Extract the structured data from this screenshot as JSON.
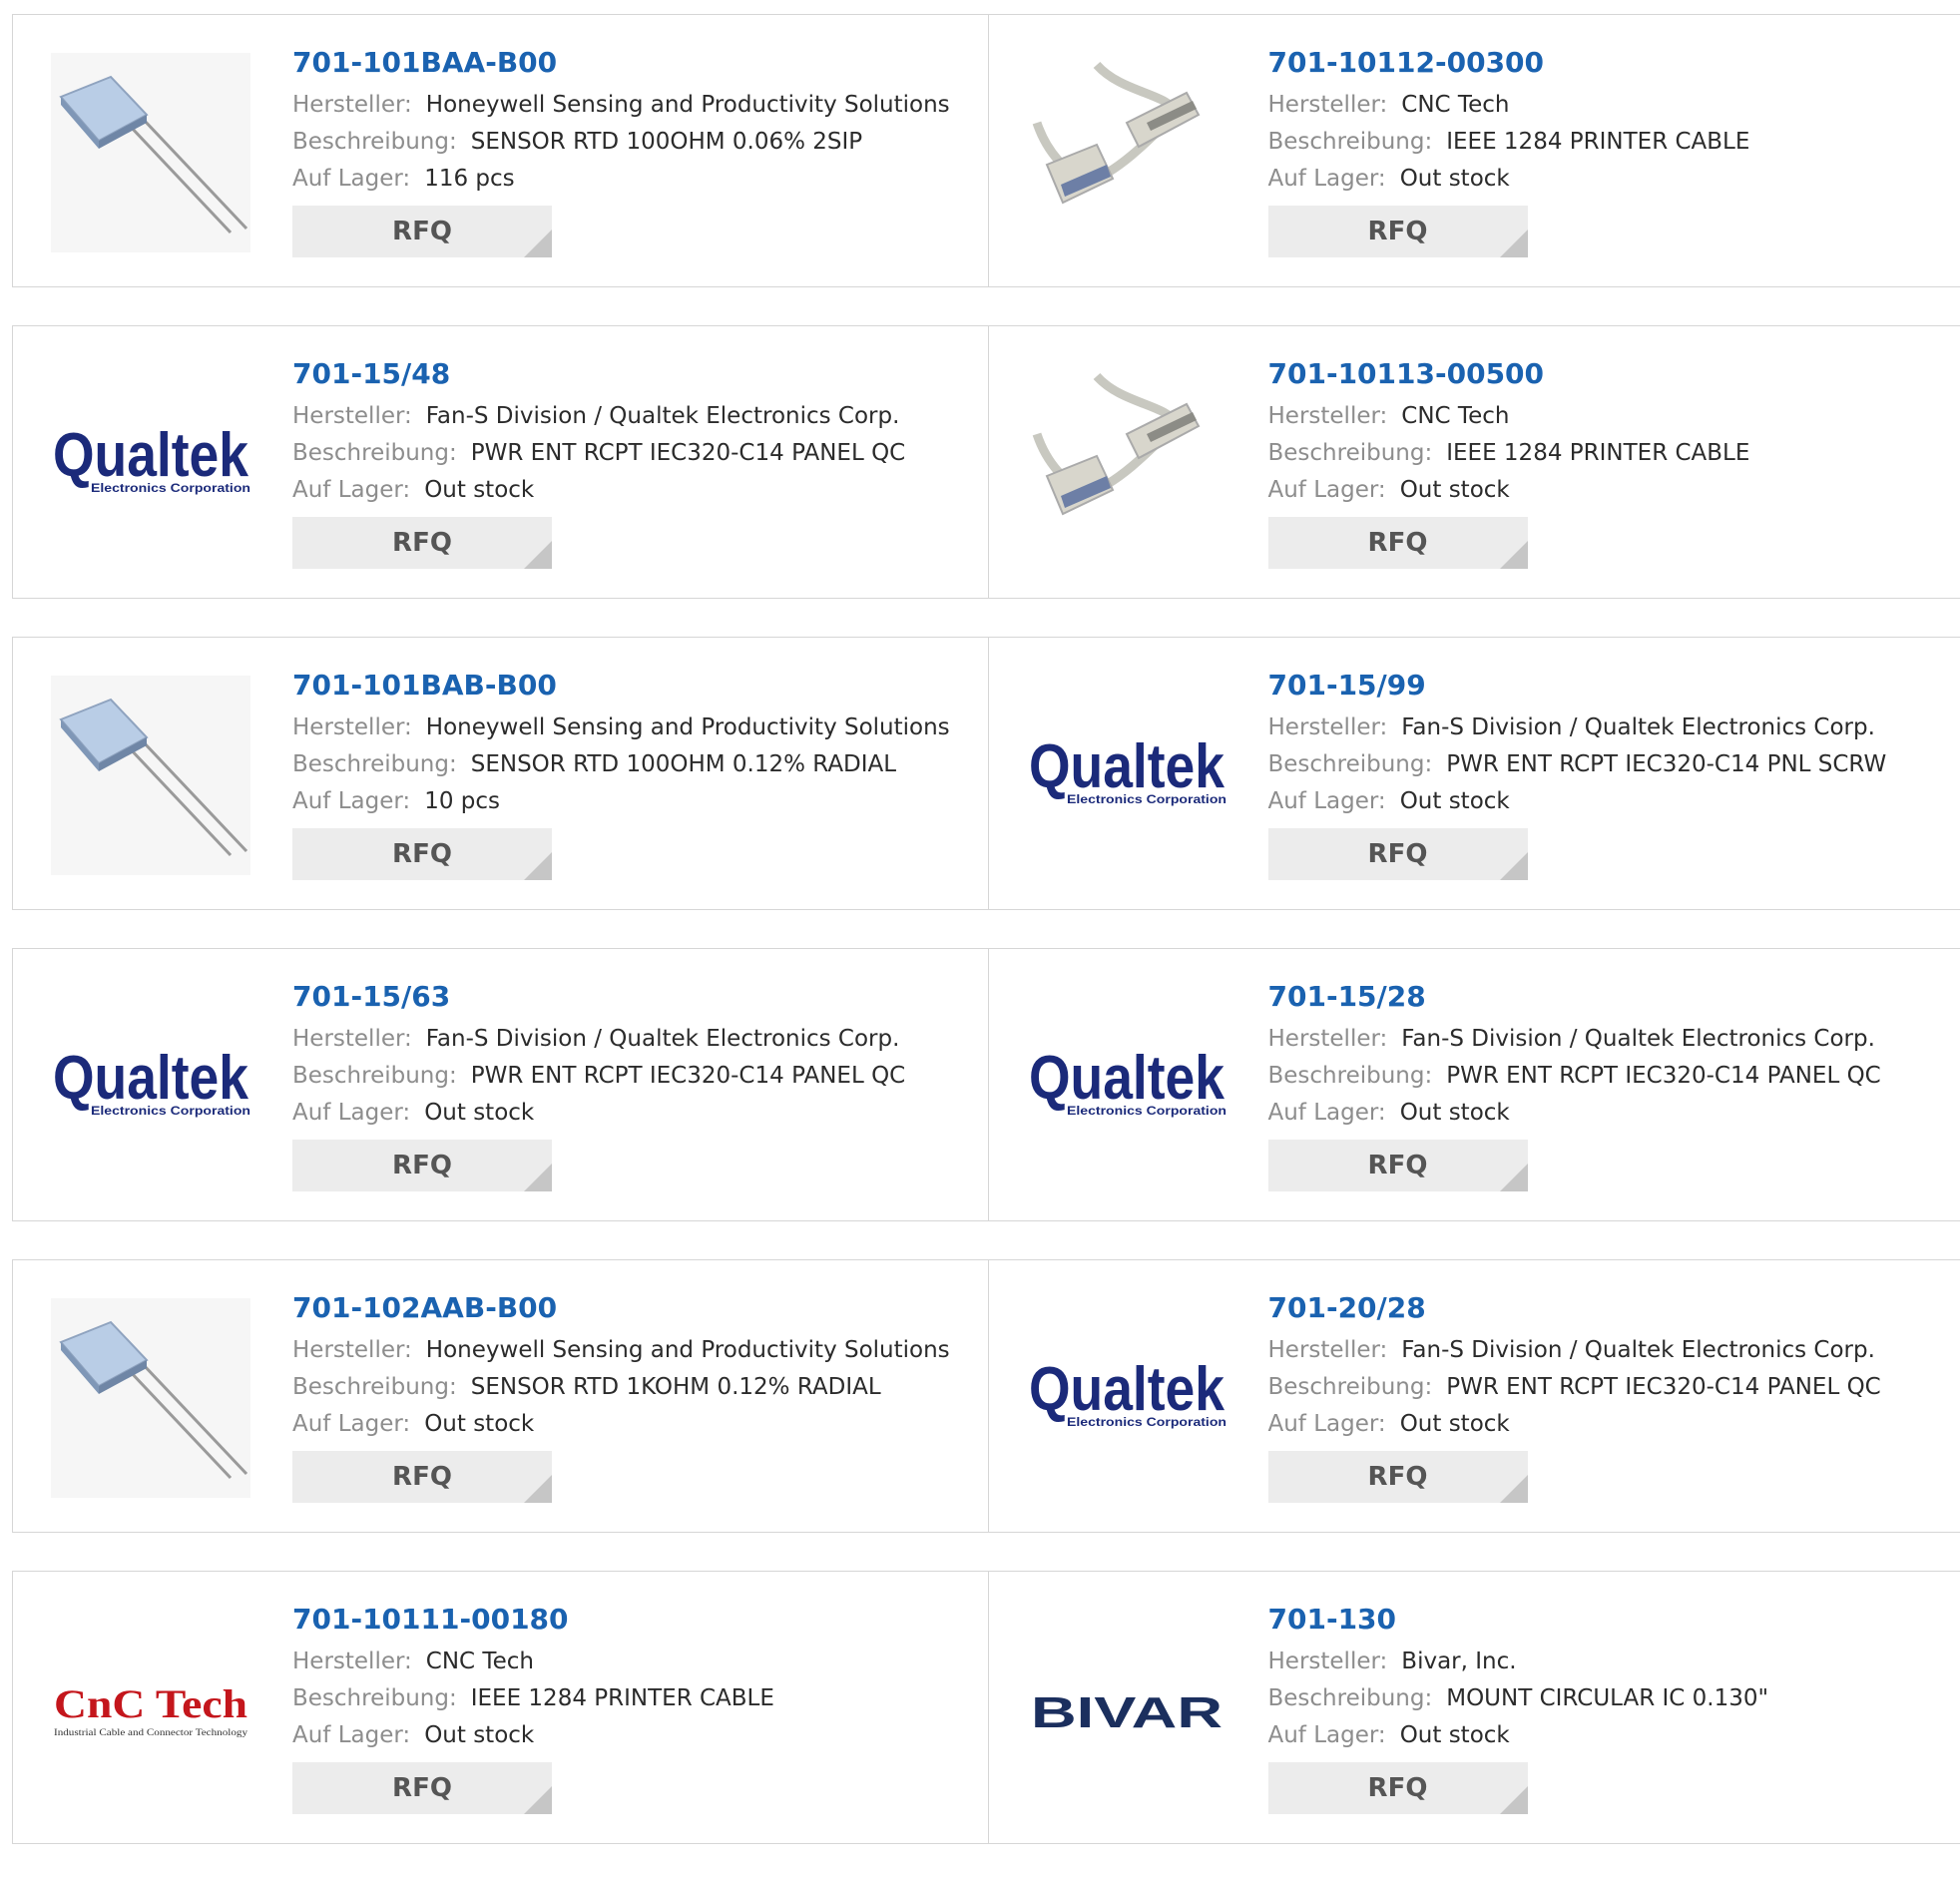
{
  "labels": {
    "manufacturer": "Hersteller:",
    "description": "Beschreibung:",
    "stock": "Auf Lager:",
    "rfq": "RFQ"
  },
  "brand_logos": {
    "qualtek": {
      "name": "Qualtek",
      "tagline": "Electronics Corporation",
      "color": "#1b2a7a"
    },
    "cnctech": {
      "name": "CnC Tech",
      "tagline": "Industrial Cable and Connector Technology",
      "color": "#c4161c"
    },
    "bivar": {
      "name": "BIVAR",
      "color": "#1b2f5e"
    }
  },
  "products": [
    {
      "part_number": "701-101BAA-B00",
      "manufacturer": "Honeywell Sensing and Productivity Solutions",
      "description": "SENSOR RTD 100OHM 0.06% 2SIP",
      "stock": "116 pcs",
      "image": "rtd-sensor"
    },
    {
      "part_number": "701-10112-00300",
      "manufacturer": "CNC Tech",
      "description": "IEEE 1284 PRINTER CABLE",
      "stock": "Out stock",
      "image": "printer-cable"
    },
    {
      "part_number": "701-15/48",
      "manufacturer": "Fan-S Division / Qualtek Electronics Corp.",
      "description": "PWR ENT RCPT IEC320-C14 PANEL QC",
      "stock": "Out stock",
      "image": "qualtek-logo"
    },
    {
      "part_number": "701-10113-00500",
      "manufacturer": "CNC Tech",
      "description": "IEEE 1284 PRINTER CABLE",
      "stock": "Out stock",
      "image": "printer-cable"
    },
    {
      "part_number": "701-101BAB-B00",
      "manufacturer": "Honeywell Sensing and Productivity Solutions",
      "description": "SENSOR RTD 100OHM 0.12% RADIAL",
      "stock": "10 pcs",
      "image": "rtd-sensor"
    },
    {
      "part_number": "701-15/99",
      "manufacturer": "Fan-S Division / Qualtek Electronics Corp.",
      "description": "PWR ENT RCPT IEC320-C14 PNL SCRW",
      "stock": "Out stock",
      "image": "qualtek-logo"
    },
    {
      "part_number": "701-15/63",
      "manufacturer": "Fan-S Division / Qualtek Electronics Corp.",
      "description": "PWR ENT RCPT IEC320-C14 PANEL QC",
      "stock": "Out stock",
      "image": "qualtek-logo"
    },
    {
      "part_number": "701-15/28",
      "manufacturer": "Fan-S Division / Qualtek Electronics Corp.",
      "description": "PWR ENT RCPT IEC320-C14 PANEL QC",
      "stock": "Out stock",
      "image": "qualtek-logo"
    },
    {
      "part_number": "701-102AAB-B00",
      "manufacturer": "Honeywell Sensing and Productivity Solutions",
      "description": "SENSOR RTD 1KOHM 0.12% RADIAL",
      "stock": "Out stock",
      "image": "rtd-sensor"
    },
    {
      "part_number": "701-20/28",
      "manufacturer": "Fan-S Division / Qualtek Electronics Corp.",
      "description": "PWR ENT RCPT IEC320-C14 PANEL QC",
      "stock": "Out stock",
      "image": "qualtek-logo"
    },
    {
      "part_number": "701-10111-00180",
      "manufacturer": "CNC Tech",
      "description": "IEEE 1284 PRINTER CABLE",
      "stock": "Out stock",
      "image": "cnctech-logo"
    },
    {
      "part_number": "701-130",
      "manufacturer": "Bivar, Inc.",
      "description": "MOUNT CIRCULAR IC 0.130\"",
      "stock": "Out stock",
      "image": "bivar-logo"
    }
  ],
  "colors": {
    "part_number": "#1a62b0",
    "label": "#8d8d8d",
    "value": "#2b2b2b",
    "rfq_bg": "#ececec",
    "border": "#d6d6d6"
  }
}
